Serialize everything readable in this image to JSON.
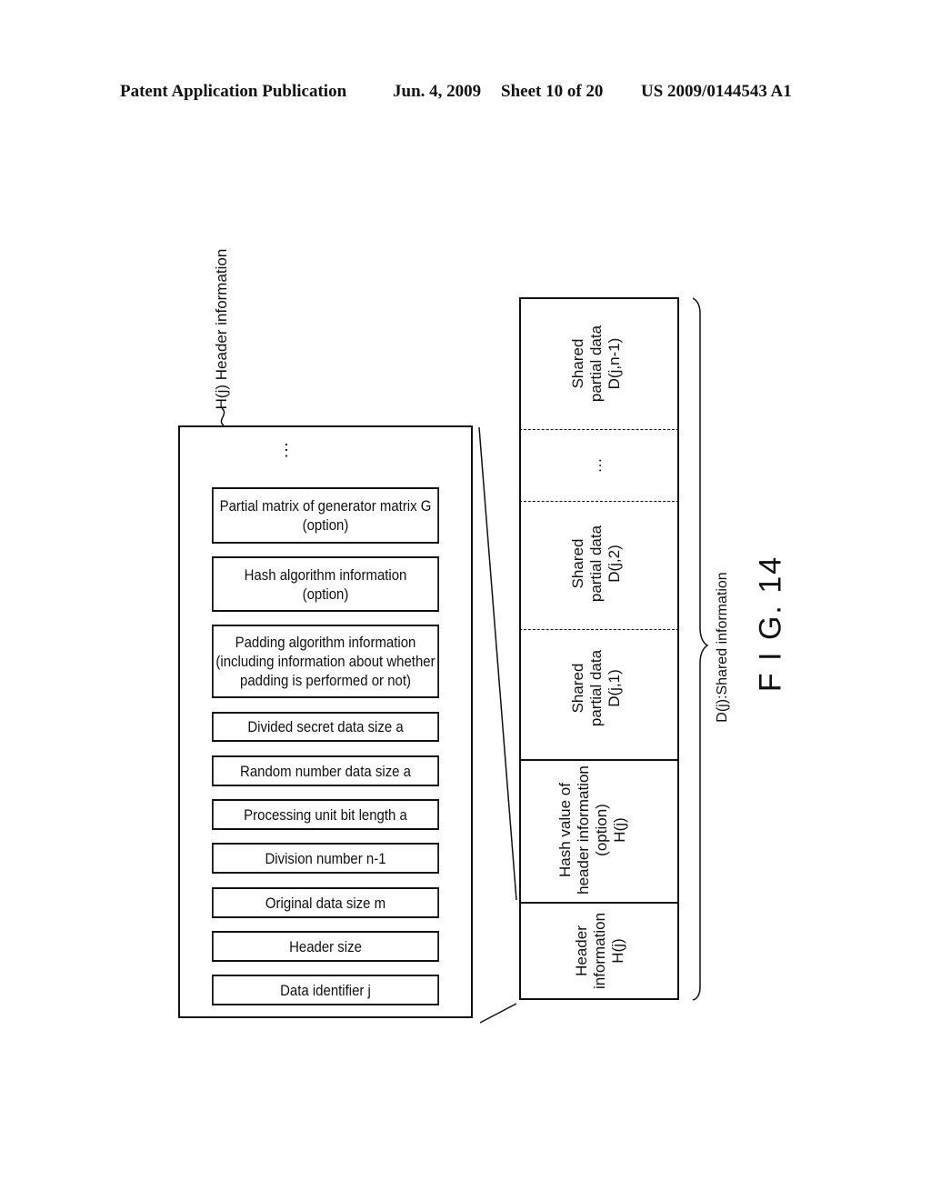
{
  "header": {
    "publication": "Patent Application Publication",
    "date": "Jun. 4, 2009",
    "sheet": "Sheet 10 of 20",
    "number": "US 2009/0144543 A1"
  },
  "header_info_label": "H(j) Header information",
  "header_fields": {
    "ellipsis": "⋮",
    "items": [
      "Partial matrix of generator matrix G (option)",
      "Hash algorithm information (option)",
      "Padding algorithm information (including information about whether padding is performed or not)",
      "Divided secret data size a",
      "Random number data size a",
      "Processing unit bit length a",
      "Division number n-1",
      "Original data size m",
      "Header size",
      "Data identifier j"
    ]
  },
  "shared_strip": {
    "cells": [
      {
        "line1": "Header",
        "line2": "information",
        "line3": "H(j)"
      },
      {
        "line1": "Hash value of",
        "line2": "header information",
        "line3": "(option)",
        "line4": "H(j)"
      },
      {
        "line1": "Shared",
        "line2": "partial data",
        "line3": "D(j,1)"
      },
      {
        "line1": "Shared",
        "line2": "partial data",
        "line3": "D(j,2)"
      },
      {
        "line1": "…"
      },
      {
        "line1": "Shared",
        "line2": "partial data",
        "line3": "D(j,n-1)"
      }
    ]
  },
  "shared_info_label": "D(j):Shared information",
  "figure_label": "F I G. 14"
}
